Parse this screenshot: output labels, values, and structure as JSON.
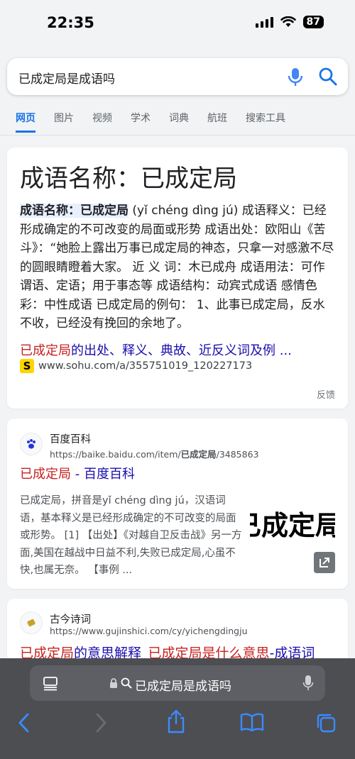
{
  "status": {
    "time": "22:35",
    "battery": "87"
  },
  "search": {
    "query": "已成定局是成语吗"
  },
  "tabs": [
    "网页",
    "图片",
    "视频",
    "学术",
    "词典",
    "航班",
    "搜索工具"
  ],
  "result1": {
    "heading": "成语名称：已成定局",
    "snippet_bold": "成语名称：已成定局",
    "snippet_rest": " (yǐ chéng dìng jú) 成语释义：已经形成确定的不可改变的局面或形势 成语出处：欧阳山《苦斗》：“她脸上露出万事已成定局的神态，只拿一对感激不尽的圆眼睛瞪着大家。 近 义 词：木已成舟 成语用法：可作谓语、定语；用于事态等 成语结构：动宾式成语 感情色彩：中性成语 已成定局的例句： 1、此事已成定局，反水不收，已经没有挽回的余地了。",
    "link_red": "已成定局",
    "link_rest": "的出处、释义、典故、近反义词及例 ...",
    "source_url": "www.sohu.com/a/355751019_120227173",
    "feedback": "反馈"
  },
  "result2": {
    "site_name": "百度百科",
    "url_prefix": "https://baike.baidu.com/item/",
    "url_bold": "已成定局",
    "url_suffix": "/3485863",
    "title_red": "已成定局",
    "title_rest": " - 百度百科",
    "snippet": "已成定局，拼音是yǐ chéng dìng jú，汉语词语，基本释义是已经形成确定的不可改变的局面或形势。 [1] 【出处】《对越自卫反击战》另一方面,美国在越战中日益不利,失败已成定局,心虽不快,也属无奈。 【事例 ...",
    "thumb_text": "已成定局"
  },
  "result3": {
    "site_name": "古今诗词",
    "url": "https://www.gujinshici.com/cy/yichengdingju",
    "title_red1": "已成定局",
    "title_mid": "的意思解释_",
    "title_red2": "已成定局是什么意思",
    "title_tail": "-成语词"
  },
  "browser": {
    "address": "已成定局是成语吗"
  },
  "colors": {
    "link_blue": "#1a0dab",
    "highlight_red": "#c5221f",
    "tab_blue": "#1a73e8"
  }
}
